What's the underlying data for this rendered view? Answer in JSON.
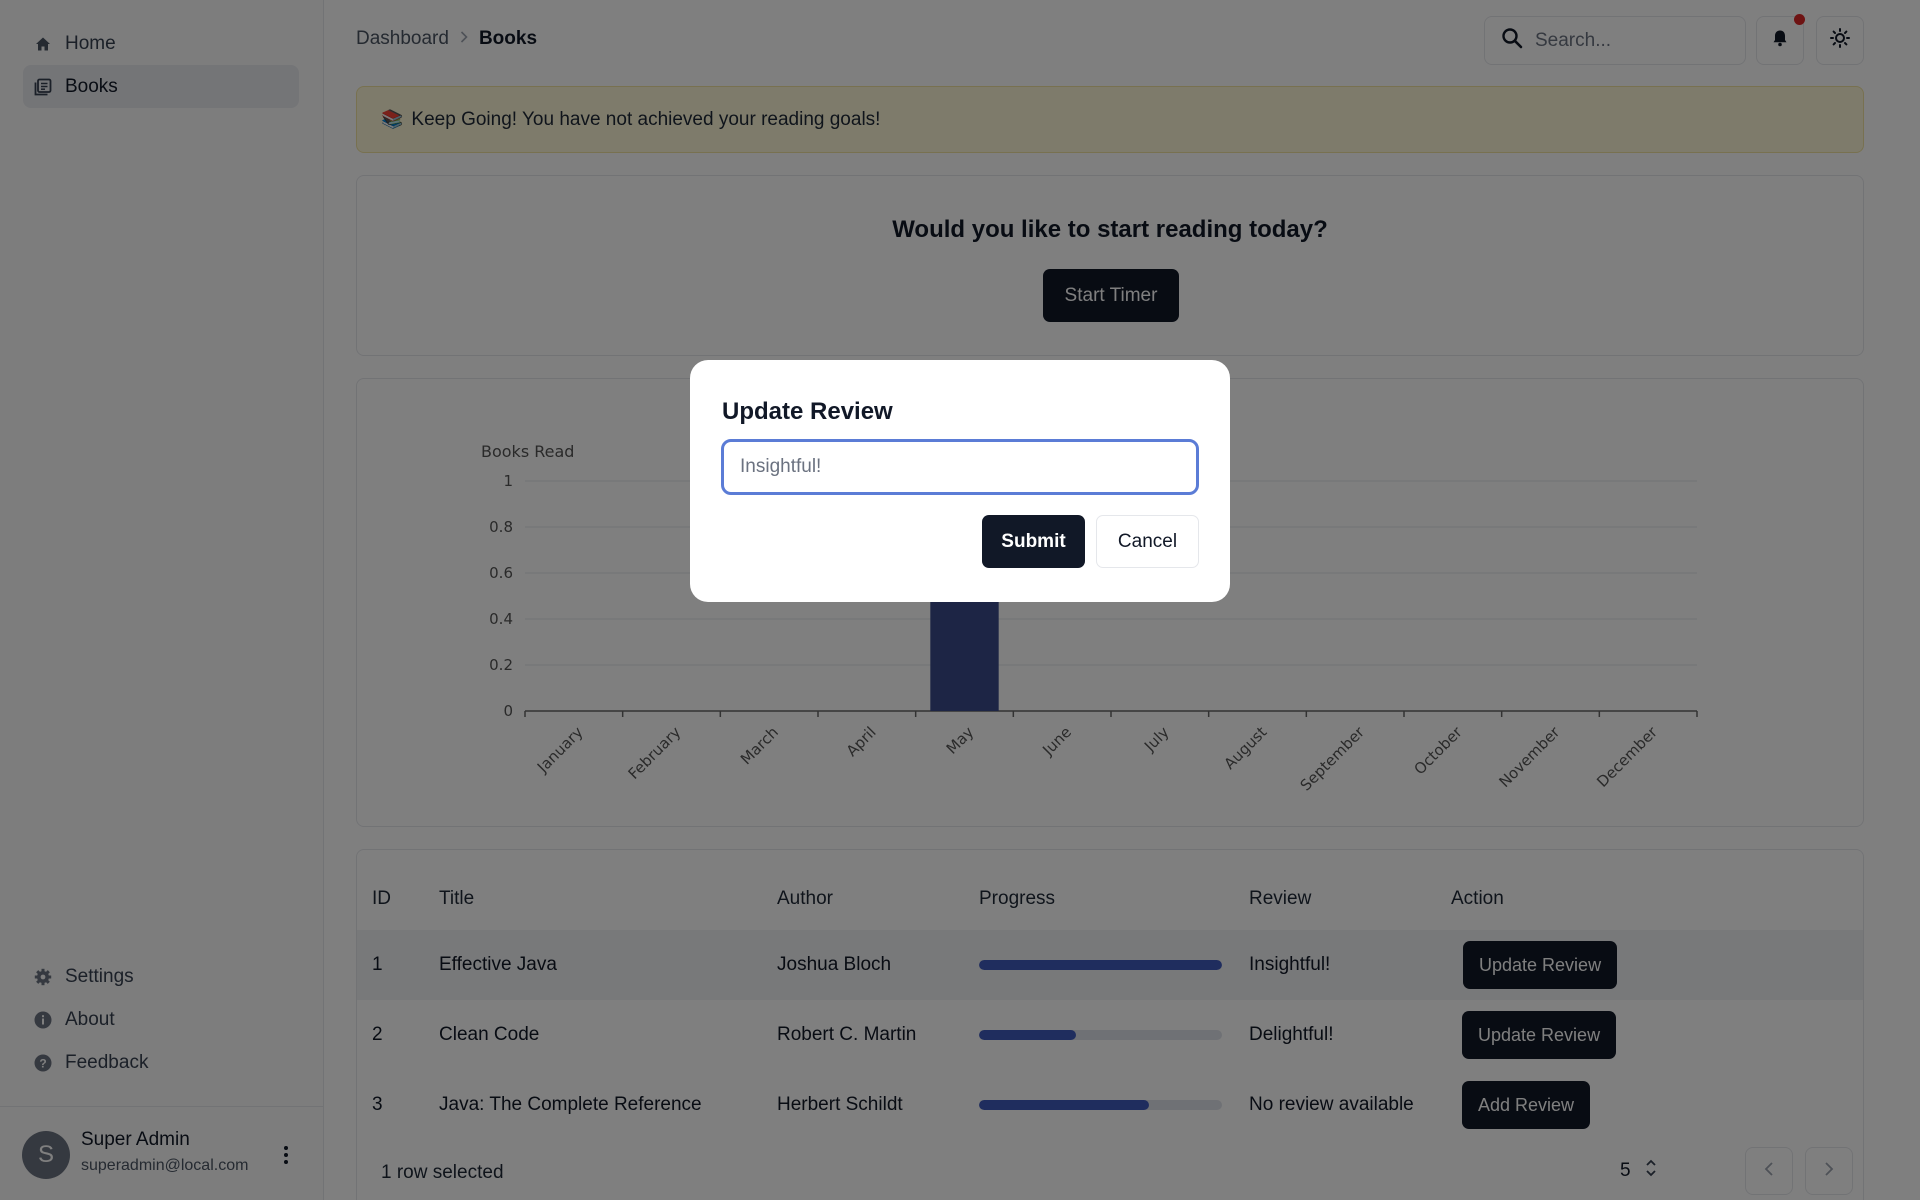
{
  "sidebar": {
    "nav": [
      {
        "label": "Home",
        "icon": "home-icon"
      },
      {
        "label": "Books",
        "icon": "book-icon"
      }
    ],
    "bottom_nav": [
      {
        "label": "Settings",
        "icon": "gear-icon"
      },
      {
        "label": "About",
        "icon": "info-icon"
      },
      {
        "label": "Feedback",
        "icon": "help-icon"
      }
    ],
    "user": {
      "initial": "S",
      "name": "Super Admin",
      "email": "superadmin@local.com"
    }
  },
  "header": {
    "breadcrumb": {
      "parent": "Dashboard",
      "current": "Books"
    },
    "search_placeholder": "Search..."
  },
  "alert": {
    "emoji": "📚",
    "text": "Keep Going! You have not achieved your reading goals!"
  },
  "timer": {
    "title": "Would you like to start reading today?",
    "button": "Start Timer"
  },
  "chart_data": {
    "type": "bar",
    "ylabel": "Books Read",
    "categories": [
      "January",
      "February",
      "March",
      "April",
      "May",
      "June",
      "July",
      "August",
      "September",
      "October",
      "November",
      "December"
    ],
    "values": [
      0,
      0,
      0,
      0,
      1,
      0,
      0,
      0,
      0,
      0,
      0,
      0
    ],
    "ylim": [
      0,
      1
    ],
    "yticks": [
      "0",
      "0.2",
      "0.4",
      "0.6",
      "0.8",
      "1"
    ],
    "bar_color": "#3b4a8a"
  },
  "table": {
    "headers": {
      "id": "ID",
      "title": "Title",
      "author": "Author",
      "progress": "Progress",
      "review": "Review",
      "action": "Action"
    },
    "rows": [
      {
        "id": "1",
        "title": "Effective Java",
        "author": "Joshua Bloch",
        "progress": 1.0,
        "review": "Insightful!",
        "action": "Update Review",
        "selected": true
      },
      {
        "id": "2",
        "title": "Clean Code",
        "author": "Robert C. Martin",
        "progress": 0.4,
        "review": "Delightful!",
        "action": "Update Review",
        "selected": false
      },
      {
        "id": "3",
        "title": "Java: The Complete Reference",
        "author": "Herbert Schildt",
        "progress": 0.7,
        "review": "No review available",
        "action": "Add Review",
        "selected": false
      }
    ],
    "footer": {
      "selected_text": "1 row selected",
      "page_size": "5"
    }
  },
  "modal": {
    "title": "Update Review",
    "input_placeholder": "Insightful!",
    "submit": "Submit",
    "cancel": "Cancel"
  },
  "colors": {
    "accent": "#111827",
    "progress": "#3f5bbd",
    "alert_bg": "#fdf7d6",
    "notification": "#dc2626"
  }
}
